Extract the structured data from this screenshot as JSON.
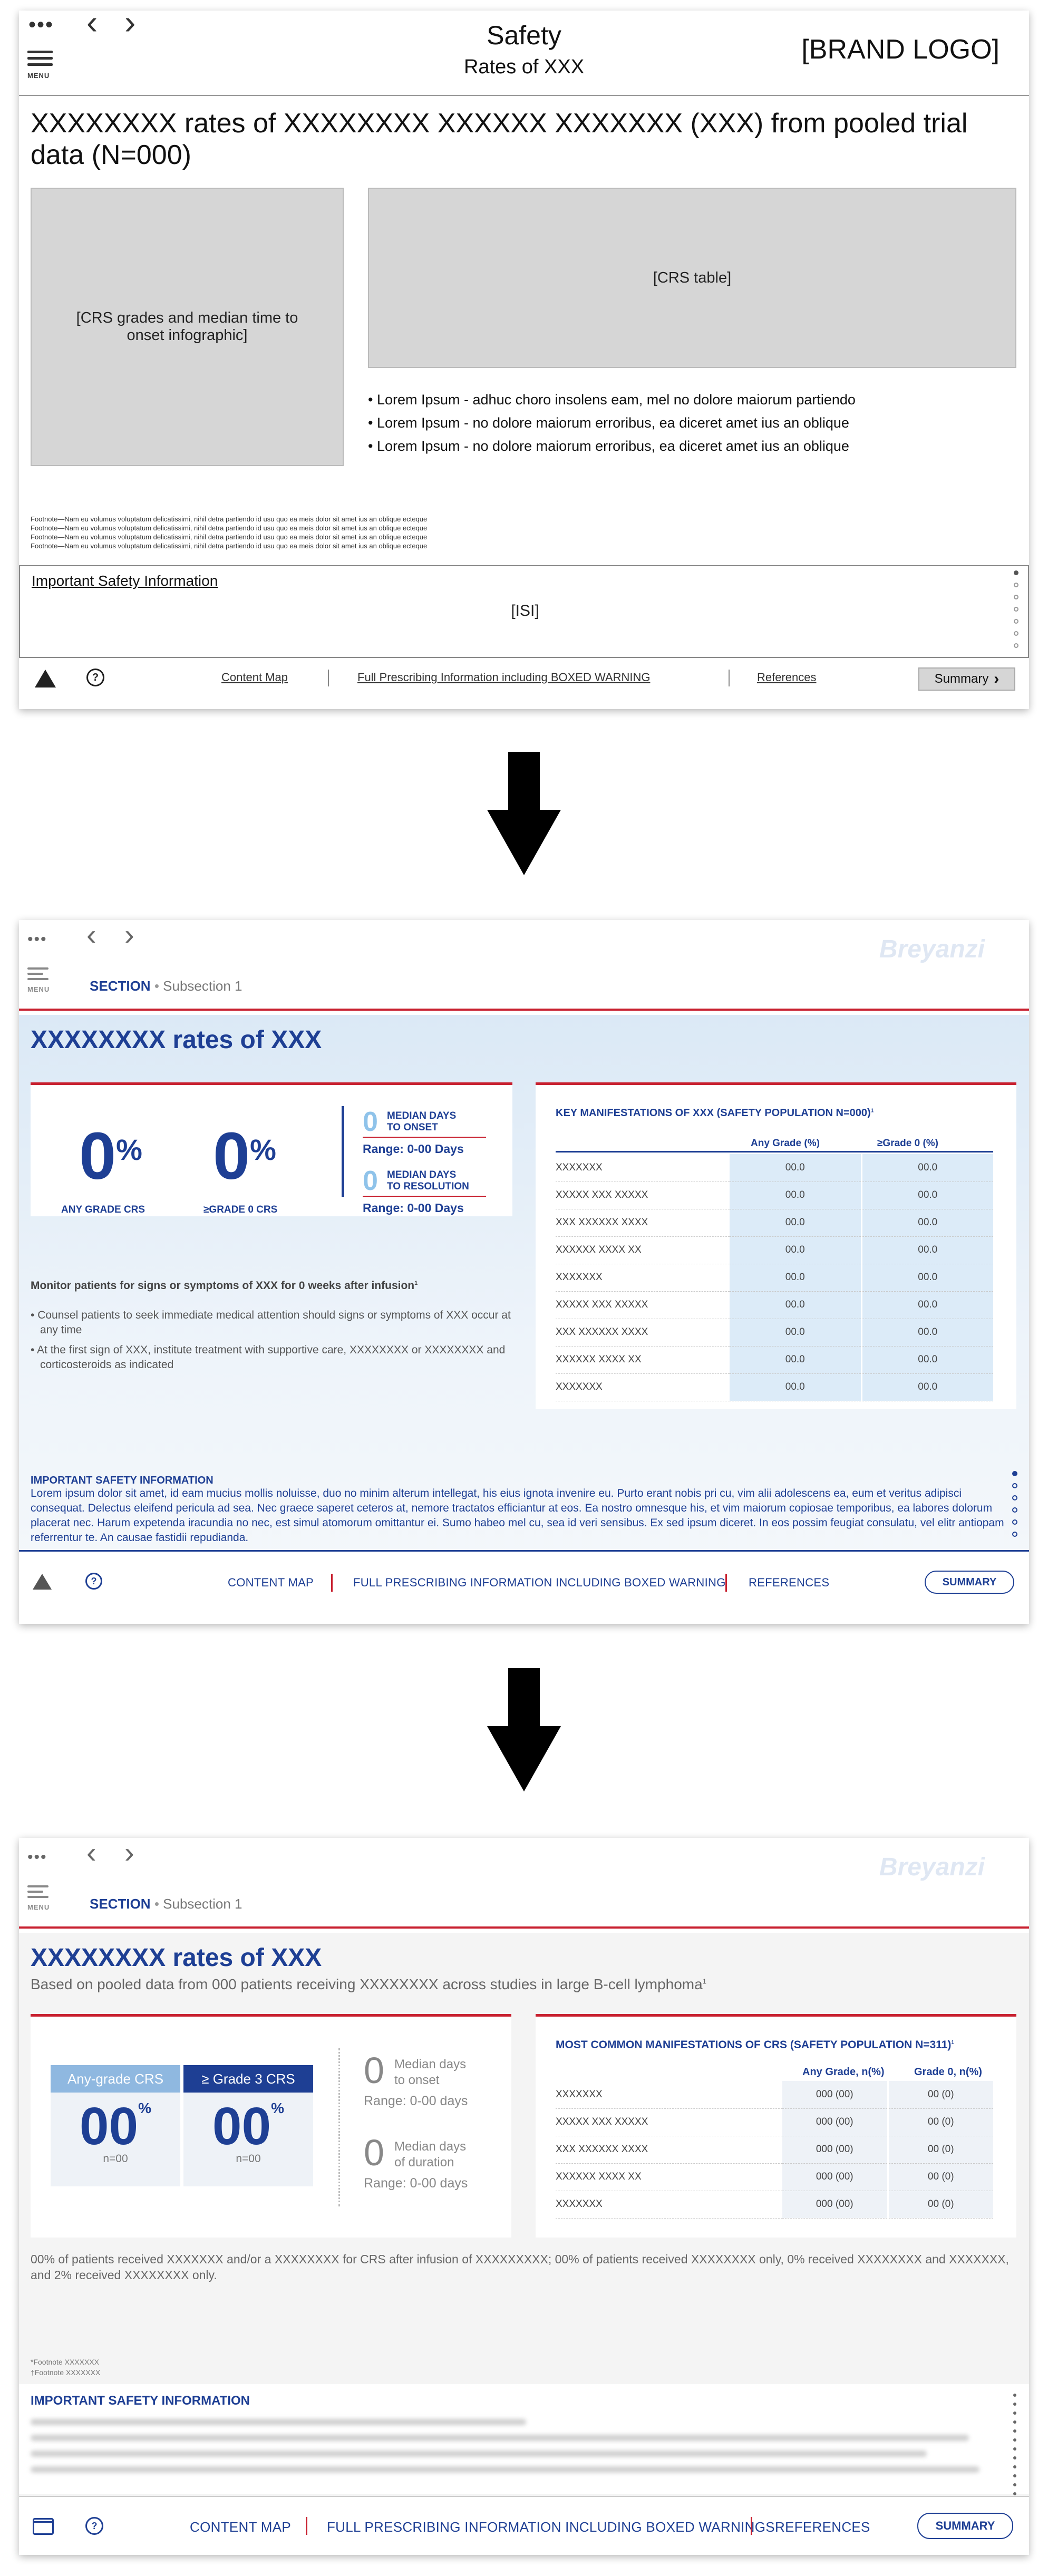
{
  "panel1": {
    "header_title": "Safety",
    "header_subtitle": "Rates of XXX",
    "brand_logo": "[BRAND LOGO]",
    "menu_label": "MENU",
    "heading": "XXXXXXXX rates of XXXXXXXX XXXXXX XXXXXXX (XXX) from pooled trial data (N=000)",
    "infographic_placeholder": "[CRS grades and median time to onset infographic]",
    "table_placeholder": "[CRS table]",
    "bullets": [
      "Lorem Ipsum -  adhuc choro insolens eam, mel no dolore maiorum partiendo",
      "Lorem Ipsum - no dolore maiorum erroribus, ea diceret amet ius an oblique",
      "Lorem Ipsum - no dolore maiorum erroribus, ea diceret amet ius an oblique"
    ],
    "footnotes": [
      "Footnote—Nam eu volumus voluptatum delicatissimi, nihil detra partiendo id usu quo ea meis  dolor sit amet ius an oblique ecteque",
      "Footnote—Nam eu volumus voluptatum delicatissimi, nihil detra partiendo id usu quo ea meis  dolor sit amet ius an oblique ecteque",
      "Footnote—Nam eu volumus voluptatum delicatissimi, nihil detra partiendo id usu quo ea meis  dolor sit amet ius an oblique ecteque",
      "Footnote—Nam eu volumus voluptatum delicatissimi, nihil detra partiendo id usu quo ea meis  dolor sit amet ius an oblique ecteque"
    ],
    "isi_title": "Important Safety Information",
    "isi_placeholder": "[ISI]",
    "nav": {
      "content_map": "Content Map",
      "full_pi": "Full Prescribing Information including BOXED WARNING",
      "references": "References",
      "summary": "Summary",
      "help_icon_glyph": "?"
    }
  },
  "panel2": {
    "menu_label": "MENU",
    "section": "SECTION",
    "subsection": "Subsection 1",
    "logo_text": "Breyanzi",
    "heading": "XXXXXXXX rates of XXX",
    "stats": {
      "any_grade_value": "0",
      "any_grade_label": "ANY GRADE CRS",
      "grade3_value": "0",
      "grade3_label": "≥GRADE 0 CRS",
      "percent": "%",
      "onset_value": "0",
      "onset_label_1": "MEDIAN DAYS",
      "onset_label_2": "TO ONSET",
      "onset_range": "Range: 0-00 Days",
      "resolution_value": "0",
      "resolution_label_1": "MEDIAN DAYS",
      "resolution_label_2": "TO RESOLUTION",
      "resolution_range": "Range: 0-00 Days"
    },
    "monitor_text": "Monitor patients for signs or symptoms of XXX for 0 weeks after infusion",
    "monitor_sup": "1",
    "bullets": [
      "Counsel patients to seek immediate medical attention should signs or symptoms of XXX occur at any time",
      "At the first sign of XXX, institute treatment with supportive care, XXXXXXXX or XXXXXXXX and corticosteroids as indicated"
    ],
    "table": {
      "title": "KEY MANIFESTATIONS OF XXX (SAFETY POPULATION N=000)",
      "title_sup": "1",
      "col1": "Any Grade (%)",
      "col2": "≥Grade 0 (%)",
      "rows": [
        {
          "label": "XXXXXXX",
          "a": "00.0",
          "b": "00.0"
        },
        {
          "label": "XXXXX XXX XXXXX",
          "a": "00.0",
          "b": "00.0"
        },
        {
          "label": "XXX XXXXXX XXXX",
          "a": "00.0",
          "b": "00.0"
        },
        {
          "label": " XXXXXX XXXX XX",
          "a": "00.0",
          "b": "00.0"
        },
        {
          "label": "XXXXXXX",
          "a": "00.0",
          "b": "00.0"
        },
        {
          "label": "XXXXX XXX XXXXX",
          "a": "00.0",
          "b": "00.0"
        },
        {
          "label": "XXX XXXXXX XXXX",
          "a": "00.0",
          "b": "00.0"
        },
        {
          "label": " XXXXXX XXXX XX",
          "a": "00.0",
          "b": "00.0"
        },
        {
          "label": "XXXXXXX",
          "a": "00.0",
          "b": "00.0"
        }
      ]
    },
    "isi_title": "IMPORTANT SAFETY INFORMATION",
    "isi_body": "Lorem ipsum dolor sit amet, id eam mucius mollis noluisse, duo no minim alterum intellegat, his eius ignota invenire eu. Purto erant nobis pri cu, vim alii adolescens ea, eum et veritus adipisci consequat. Delectus eleifend pericula ad sea. Nec graece saperet ceteros at, nemore tractatos efficiantur at eos. Ea nostro omnesque his, et vim maiorum copiosae temporibus, ea labores dolorum placerat nec. Harum expetenda iracundia no nec, est simul atomorum omittantur ei. Sumo habeo mel cu, sea id veri sensibus. Ex sed ipsum diceret. In eos possim feugiat consulatu, vel elitr antiopam referrentur te. An causae fastidii repudianda.",
    "nav": {
      "content_map": "CONTENT MAP",
      "full_pi": "FULL PRESCRIBING INFORMATION INCLUDING BOXED WARNING",
      "references": "REFERENCES",
      "summary": "SUMMARY",
      "help_icon_glyph": "?"
    },
    "accent_blue": "#1e3f94",
    "accent_red": "#c8202f"
  },
  "panel3": {
    "menu_label": "MENU",
    "section": "SECTION",
    "subsection": "Subsection 1",
    "logo_text": "Breyanzi",
    "heading": "XXXXXXXX rates of XXX",
    "subheading": "Based on pooled data from 000 patients receiving XXXXXXXX across studies in large B-cell lymphoma",
    "subheading_sup": "1",
    "stats": {
      "any_grade_header": "Any-grade CRS",
      "grade3_header": "≥ Grade 3 CRS",
      "any_grade_value": "00",
      "grade3_value": "00",
      "percent": "%",
      "any_grade_n": "n=00",
      "grade3_n": "n=00",
      "onset_value": "0",
      "onset_label_1": "Median days",
      "onset_label_2": "to onset",
      "onset_range": "Range: 0-00 days",
      "duration_value": "0",
      "duration_label_1": "Median days",
      "duration_label_2": "of duration",
      "duration_range": "Range: 0-00 days"
    },
    "table": {
      "title": "MOST COMMON MANIFESTATIONS OF CRS (SAFETY POPULATION N=311)",
      "title_sup": "1",
      "col1": "Any Grade, n(%)",
      "col2": "Grade 0, n(%)",
      "rows": [
        {
          "label": "XXXXXXX",
          "a": "000 (00)",
          "b": "00 (0)"
        },
        {
          "label": "XXXXX XXX XXXXX",
          "a": "000 (00)",
          "b": "00 (0)"
        },
        {
          "label": "XXX XXXXXX XXXX",
          "a": "000 (00)",
          "b": "00 (0)"
        },
        {
          "label": " XXXXXX XXXX XX",
          "a": "000 (00)",
          "b": "00 (0)"
        },
        {
          "label": "XXXXXXX",
          "a": "000 (00)",
          "b": "00 (0)"
        }
      ]
    },
    "summary_text": "00% of patients received XXXXXXX and/or a XXXXXXXX for CRS after infusion of XXXXXXXXX; 00% of patients received XXXXXXXX only, 0% received XXXXXXXX and XXXXXXX, and 2% received XXXXXXXX only.",
    "footnotes": [
      "*Footnote XXXXXXX",
      "†Footnote XXXXXXX"
    ],
    "isi_title": "IMPORTANT SAFETY INFORMATION",
    "nav": {
      "content_map": "CONTENT MAP",
      "full_pi": "FULL PRESCRIBING INFORMATION INCLUDING BOXED WARNINGS",
      "references": "REFERENCES",
      "summary": "SUMMARY",
      "help_icon_glyph": "?"
    },
    "header_blue": "#1e3f94",
    "header_light_blue": "#8fb8e0"
  },
  "icons": {
    "arrow_down": "large-down-arrow-icon",
    "back": "chevron-left-icon",
    "forward": "chevron-right-icon",
    "more": "more-dots-icon",
    "menu": "hamburger-menu-icon"
  },
  "glyphs": {
    "more_dots": "•••",
    "chevron_left": "‹",
    "chevron_right": "›",
    "summary_arrow": "›",
    "bullet": "•"
  }
}
